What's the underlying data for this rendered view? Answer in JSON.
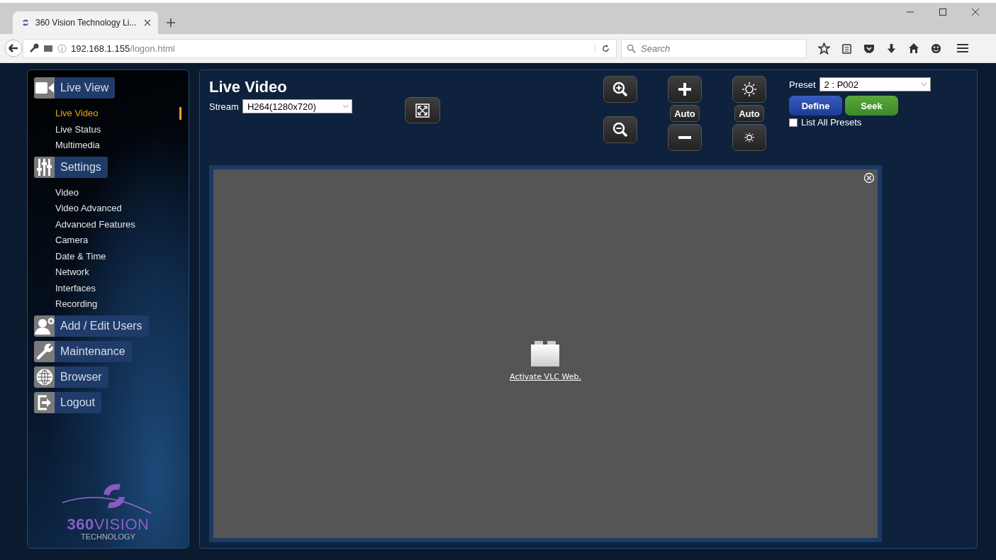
{
  "browser": {
    "tab_title": "360 Vision Technology Li...",
    "url_host": "192.168.1.155",
    "url_path": "/logon.html",
    "search": {
      "placeholder": "Search"
    }
  },
  "sidebar": {
    "sections": [
      {
        "label": "Live View",
        "kind": "camera",
        "items": [
          {
            "label": "Live Video",
            "selected": true
          },
          {
            "label": "Live Status",
            "selected": false
          },
          {
            "label": "Multimedia",
            "selected": false
          }
        ]
      },
      {
        "label": "Settings",
        "kind": "sliders",
        "items": [
          {
            "label": "Video",
            "selected": false
          },
          {
            "label": "Video Advanced",
            "selected": false
          },
          {
            "label": "Advanced Features",
            "selected": false
          },
          {
            "label": "Camera",
            "selected": false
          },
          {
            "label": "Date & Time",
            "selected": false
          },
          {
            "label": "Network",
            "selected": false
          },
          {
            "label": "Interfaces",
            "selected": false
          },
          {
            "label": "Recording",
            "selected": false
          }
        ]
      },
      {
        "label": "Add / Edit Users",
        "kind": "user-add"
      },
      {
        "label": "Maintenance",
        "kind": "wrench"
      },
      {
        "label": "Browser",
        "kind": "globe"
      },
      {
        "label": "Logout",
        "kind": "logout"
      }
    ],
    "logo": {
      "brand_a": "360",
      "brand_b": "VISION",
      "subtitle": "TECHNOLOGY"
    }
  },
  "main": {
    "title": "Live Video",
    "stream": {
      "label": "Stream",
      "value": "H264(1280x720)"
    },
    "focus_auto": "Auto",
    "iris_auto": "Auto",
    "preset": {
      "label": "Preset",
      "value": "2 : P002",
      "buttons": [
        "Define",
        "Seek"
      ],
      "list_all": {
        "label": "List All Presets",
        "checked": false
      }
    },
    "video": {
      "link": "Activate VLC Web."
    }
  }
}
